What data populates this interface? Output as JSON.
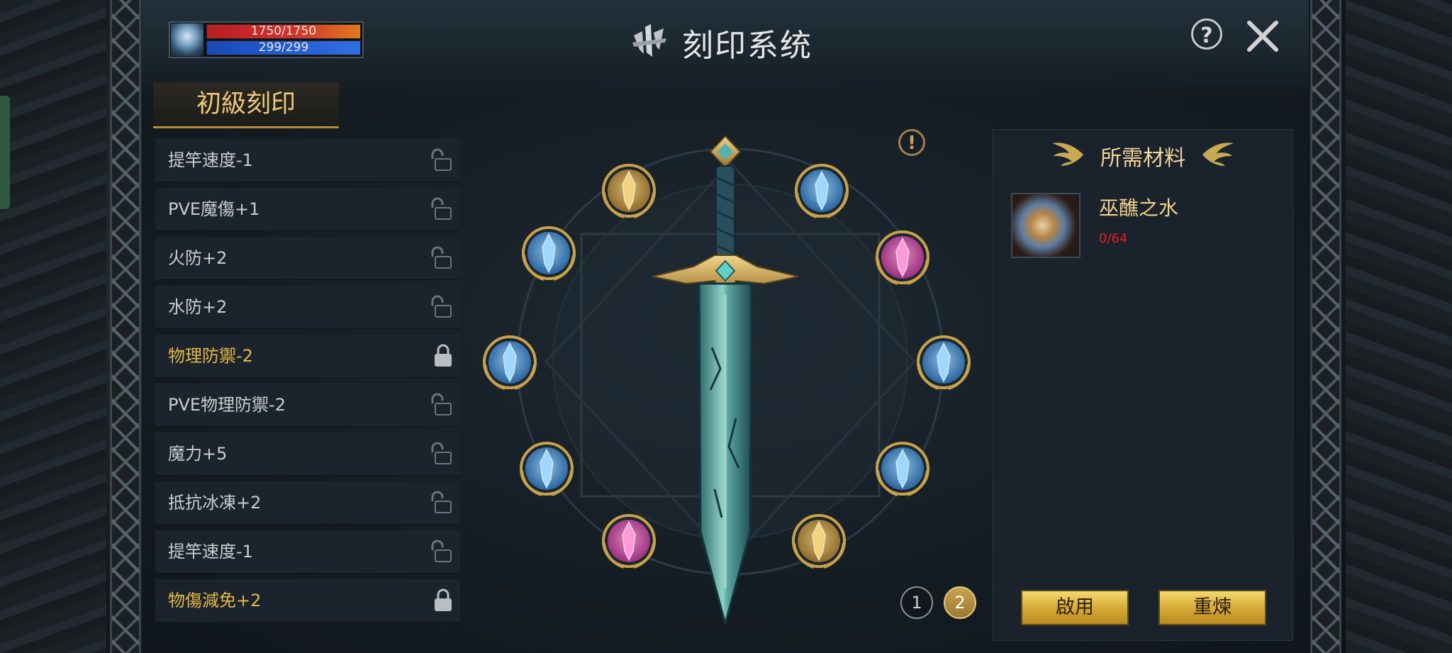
{
  "player": {
    "hp_text": "1750/1750",
    "mp_text": "299/299",
    "hp_fraction": 1.0,
    "mp_fraction": 1.0
  },
  "header": {
    "title": "刻印系统",
    "help_icon": "question-circle-icon",
    "close_icon": "close-x-icon"
  },
  "tab": {
    "label": "初級刻印"
  },
  "list": {
    "items": [
      {
        "label": "提竿速度-1",
        "locked": false
      },
      {
        "label": "PVE魔傷+1",
        "locked": false
      },
      {
        "label": "火防+2",
        "locked": false
      },
      {
        "label": "水防+2",
        "locked": false
      },
      {
        "label": "物理防禦-2",
        "locked": true
      },
      {
        "label": "PVE物理防禦-2",
        "locked": false
      },
      {
        "label": "魔力+5",
        "locked": false
      },
      {
        "label": "抵抗冰凍+2",
        "locked": false
      },
      {
        "label": "提竿速度-1",
        "locked": false
      },
      {
        "label": "物傷減免+2",
        "locked": true
      }
    ]
  },
  "center": {
    "warning_symbol": "!",
    "weapon": "sword",
    "gems": [
      "gold",
      "blue",
      "blue",
      "pink",
      "blue",
      "blue",
      "blue",
      "blue",
      "pink",
      "gold"
    ]
  },
  "pagination": {
    "pages": [
      "1",
      "2"
    ],
    "current": "2"
  },
  "materials": {
    "title": "所需材料",
    "item_name": "巫醮之水",
    "item_count": "0/64"
  },
  "buttons": {
    "enable": "啟用",
    "refine": "重煉"
  },
  "colors": {
    "gold_text": "#e6b845",
    "normal_text": "#c9ced2",
    "count_red": "#e31d1d",
    "button_gold": "#d7ac38"
  }
}
